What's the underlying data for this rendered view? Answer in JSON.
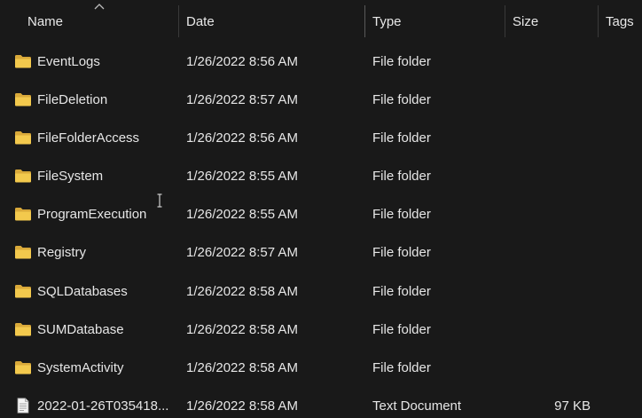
{
  "columns": {
    "name": "Name",
    "date": "Date",
    "type": "Type",
    "size": "Size",
    "tags": "Tags"
  },
  "sort_indicator_icon": "sort-ascending-icon",
  "files": [
    {
      "name": "EventLogs",
      "date": "1/26/2022 8:56 AM",
      "type": "File folder",
      "size": "",
      "icon": "folder-icon"
    },
    {
      "name": "FileDeletion",
      "date": "1/26/2022 8:57 AM",
      "type": "File folder",
      "size": "",
      "icon": "folder-icon"
    },
    {
      "name": "FileFolderAccess",
      "date": "1/26/2022 8:56 AM",
      "type": "File folder",
      "size": "",
      "icon": "folder-icon"
    },
    {
      "name": "FileSystem",
      "date": "1/26/2022 8:55 AM",
      "type": "File folder",
      "size": "",
      "icon": "folder-icon"
    },
    {
      "name": "ProgramExecution",
      "date": "1/26/2022 8:55 AM",
      "type": "File folder",
      "size": "",
      "icon": "folder-icon"
    },
    {
      "name": "Registry",
      "date": "1/26/2022 8:57 AM",
      "type": "File folder",
      "size": "",
      "icon": "folder-icon"
    },
    {
      "name": "SQLDatabases",
      "date": "1/26/2022 8:58 AM",
      "type": "File folder",
      "size": "",
      "icon": "folder-icon"
    },
    {
      "name": "SUMDatabase",
      "date": "1/26/2022 8:58 AM",
      "type": "File folder",
      "size": "",
      "icon": "folder-icon"
    },
    {
      "name": "SystemActivity",
      "date": "1/26/2022 8:58 AM",
      "type": "File folder",
      "size": "",
      "icon": "folder-icon"
    },
    {
      "name": "2022-01-26T035418...",
      "date": "1/26/2022 8:58 AM",
      "type": "Text Document",
      "size": "97 KB",
      "icon": "text-document-icon"
    }
  ],
  "colors": {
    "background": "#191919",
    "text": "#e6e6e6",
    "folder": "#f3c94d"
  }
}
